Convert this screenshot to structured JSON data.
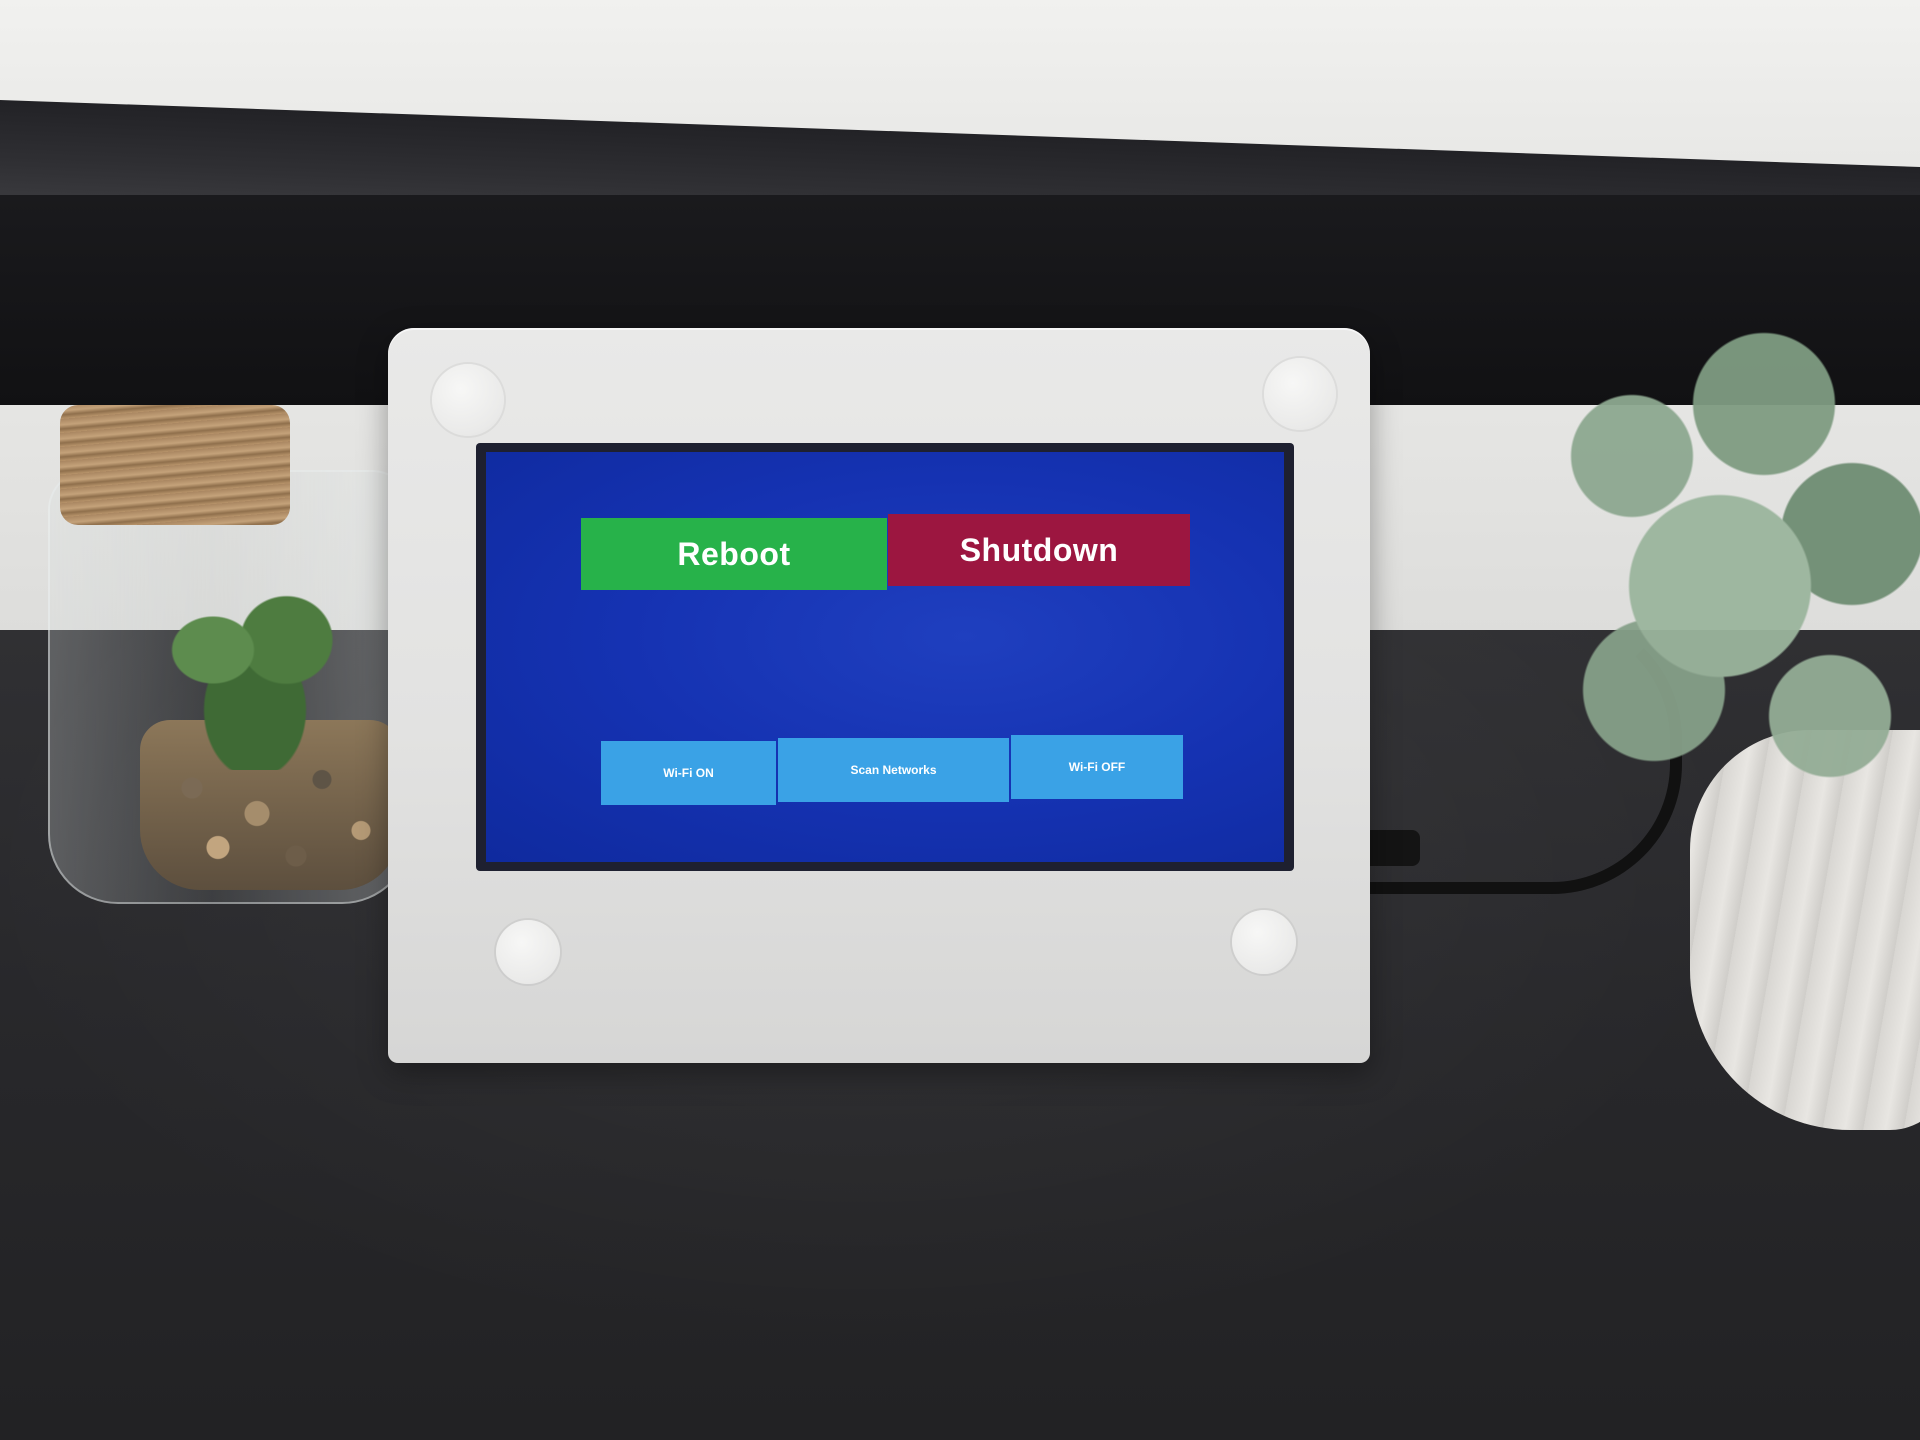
{
  "screen": {
    "power_buttons": {
      "reboot_label": "Reboot",
      "shutdown_label": "Shutdown"
    },
    "wifi_buttons": {
      "wifi_on_label": "Wi-Fi ON",
      "scan_label": "Scan Networks",
      "wifi_off_label": "Wi-Fi OFF"
    }
  },
  "colors": {
    "screen_background": "#1532b2",
    "reboot": "#27b24a",
    "shutdown": "#9c1640",
    "wifi_buttons": "#3aa2e6",
    "device_case": "#e4e4e3",
    "desk": "#2a2a2c"
  }
}
